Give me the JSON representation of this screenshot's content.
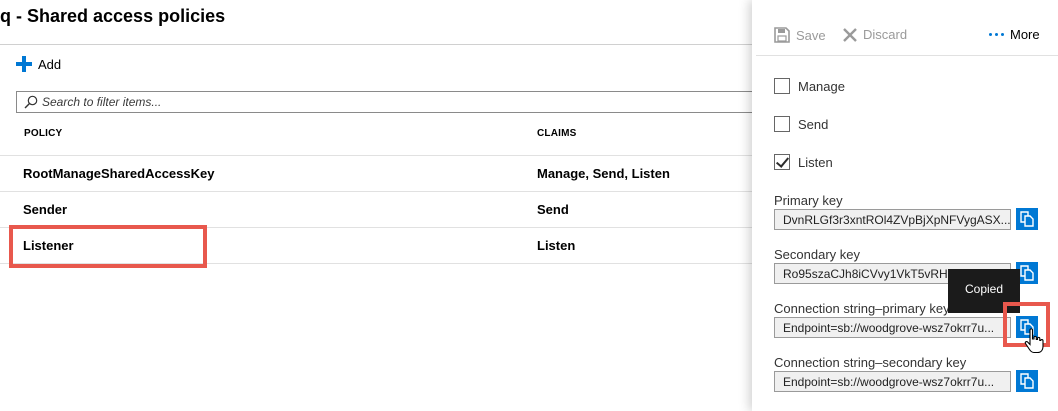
{
  "blade": {
    "title": "q - Shared access policies",
    "add_label": "Add",
    "search_placeholder": "Search to filter items...",
    "columns": {
      "policy": "POLICY",
      "claims": "CLAIMS"
    },
    "rows": [
      {
        "policy": "RootManageSharedAccessKey",
        "claims": "Manage, Send, Listen"
      },
      {
        "policy": "Sender",
        "claims": "Send"
      },
      {
        "policy": "Listener",
        "claims": "Listen"
      }
    ],
    "highlight_color": "#e8584d"
  },
  "panel": {
    "toolbar": {
      "save": "Save",
      "discard": "Discard",
      "more": "More"
    },
    "claims": [
      {
        "label": "Manage",
        "checked": false
      },
      {
        "label": "Send",
        "checked": false
      },
      {
        "label": "Listen",
        "checked": true
      }
    ],
    "fields": [
      {
        "label": "Primary key",
        "value": "DvnRLGf3r3xntROl4ZVpBjXpNFVygASX..."
      },
      {
        "label": "Secondary key",
        "value": "Ro95szaCJh8iCVvy1VkT5vRHQ+"
      },
      {
        "label": "Connection string–primary key",
        "value": "Endpoint=sb://woodgrove-wsz7okrr7u..."
      },
      {
        "label": "Connection string–secondary key",
        "value": "Endpoint=sb://woodgrove-wsz7okrr7u..."
      }
    ],
    "tooltip": "Copied",
    "accent_color": "#0078d4"
  }
}
